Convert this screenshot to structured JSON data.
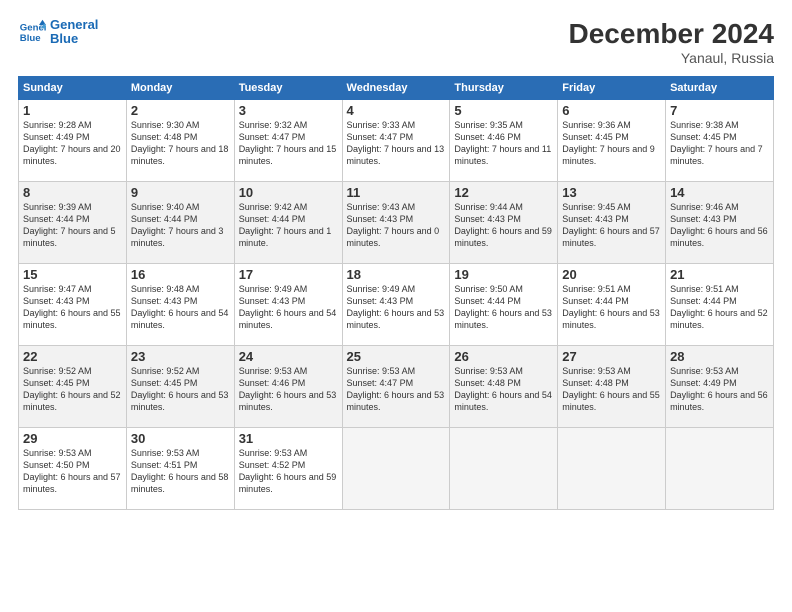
{
  "header": {
    "logo_line1": "General",
    "logo_line2": "Blue",
    "title": "December 2024",
    "subtitle": "Yanaul, Russia"
  },
  "days_of_week": [
    "Sunday",
    "Monday",
    "Tuesday",
    "Wednesday",
    "Thursday",
    "Friday",
    "Saturday"
  ],
  "weeks": [
    [
      {
        "num": "1",
        "sunrise": "Sunrise: 9:28 AM",
        "sunset": "Sunset: 4:49 PM",
        "daylight": "Daylight: 7 hours and 20 minutes."
      },
      {
        "num": "2",
        "sunrise": "Sunrise: 9:30 AM",
        "sunset": "Sunset: 4:48 PM",
        "daylight": "Daylight: 7 hours and 18 minutes."
      },
      {
        "num": "3",
        "sunrise": "Sunrise: 9:32 AM",
        "sunset": "Sunset: 4:47 PM",
        "daylight": "Daylight: 7 hours and 15 minutes."
      },
      {
        "num": "4",
        "sunrise": "Sunrise: 9:33 AM",
        "sunset": "Sunset: 4:47 PM",
        "daylight": "Daylight: 7 hours and 13 minutes."
      },
      {
        "num": "5",
        "sunrise": "Sunrise: 9:35 AM",
        "sunset": "Sunset: 4:46 PM",
        "daylight": "Daylight: 7 hours and 11 minutes."
      },
      {
        "num": "6",
        "sunrise": "Sunrise: 9:36 AM",
        "sunset": "Sunset: 4:45 PM",
        "daylight": "Daylight: 7 hours and 9 minutes."
      },
      {
        "num": "7",
        "sunrise": "Sunrise: 9:38 AM",
        "sunset": "Sunset: 4:45 PM",
        "daylight": "Daylight: 7 hours and 7 minutes."
      }
    ],
    [
      {
        "num": "8",
        "sunrise": "Sunrise: 9:39 AM",
        "sunset": "Sunset: 4:44 PM",
        "daylight": "Daylight: 7 hours and 5 minutes."
      },
      {
        "num": "9",
        "sunrise": "Sunrise: 9:40 AM",
        "sunset": "Sunset: 4:44 PM",
        "daylight": "Daylight: 7 hours and 3 minutes."
      },
      {
        "num": "10",
        "sunrise": "Sunrise: 9:42 AM",
        "sunset": "Sunset: 4:44 PM",
        "daylight": "Daylight: 7 hours and 1 minute."
      },
      {
        "num": "11",
        "sunrise": "Sunrise: 9:43 AM",
        "sunset": "Sunset: 4:43 PM",
        "daylight": "Daylight: 7 hours and 0 minutes."
      },
      {
        "num": "12",
        "sunrise": "Sunrise: 9:44 AM",
        "sunset": "Sunset: 4:43 PM",
        "daylight": "Daylight: 6 hours and 59 minutes."
      },
      {
        "num": "13",
        "sunrise": "Sunrise: 9:45 AM",
        "sunset": "Sunset: 4:43 PM",
        "daylight": "Daylight: 6 hours and 57 minutes."
      },
      {
        "num": "14",
        "sunrise": "Sunrise: 9:46 AM",
        "sunset": "Sunset: 4:43 PM",
        "daylight": "Daylight: 6 hours and 56 minutes."
      }
    ],
    [
      {
        "num": "15",
        "sunrise": "Sunrise: 9:47 AM",
        "sunset": "Sunset: 4:43 PM",
        "daylight": "Daylight: 6 hours and 55 minutes."
      },
      {
        "num": "16",
        "sunrise": "Sunrise: 9:48 AM",
        "sunset": "Sunset: 4:43 PM",
        "daylight": "Daylight: 6 hours and 54 minutes."
      },
      {
        "num": "17",
        "sunrise": "Sunrise: 9:49 AM",
        "sunset": "Sunset: 4:43 PM",
        "daylight": "Daylight: 6 hours and 54 minutes."
      },
      {
        "num": "18",
        "sunrise": "Sunrise: 9:49 AM",
        "sunset": "Sunset: 4:43 PM",
        "daylight": "Daylight: 6 hours and 53 minutes."
      },
      {
        "num": "19",
        "sunrise": "Sunrise: 9:50 AM",
        "sunset": "Sunset: 4:44 PM",
        "daylight": "Daylight: 6 hours and 53 minutes."
      },
      {
        "num": "20",
        "sunrise": "Sunrise: 9:51 AM",
        "sunset": "Sunset: 4:44 PM",
        "daylight": "Daylight: 6 hours and 53 minutes."
      },
      {
        "num": "21",
        "sunrise": "Sunrise: 9:51 AM",
        "sunset": "Sunset: 4:44 PM",
        "daylight": "Daylight: 6 hours and 52 minutes."
      }
    ],
    [
      {
        "num": "22",
        "sunrise": "Sunrise: 9:52 AM",
        "sunset": "Sunset: 4:45 PM",
        "daylight": "Daylight: 6 hours and 52 minutes."
      },
      {
        "num": "23",
        "sunrise": "Sunrise: 9:52 AM",
        "sunset": "Sunset: 4:45 PM",
        "daylight": "Daylight: 6 hours and 53 minutes."
      },
      {
        "num": "24",
        "sunrise": "Sunrise: 9:53 AM",
        "sunset": "Sunset: 4:46 PM",
        "daylight": "Daylight: 6 hours and 53 minutes."
      },
      {
        "num": "25",
        "sunrise": "Sunrise: 9:53 AM",
        "sunset": "Sunset: 4:47 PM",
        "daylight": "Daylight: 6 hours and 53 minutes."
      },
      {
        "num": "26",
        "sunrise": "Sunrise: 9:53 AM",
        "sunset": "Sunset: 4:48 PM",
        "daylight": "Daylight: 6 hours and 54 minutes."
      },
      {
        "num": "27",
        "sunrise": "Sunrise: 9:53 AM",
        "sunset": "Sunset: 4:48 PM",
        "daylight": "Daylight: 6 hours and 55 minutes."
      },
      {
        "num": "28",
        "sunrise": "Sunrise: 9:53 AM",
        "sunset": "Sunset: 4:49 PM",
        "daylight": "Daylight: 6 hours and 56 minutes."
      }
    ],
    [
      {
        "num": "29",
        "sunrise": "Sunrise: 9:53 AM",
        "sunset": "Sunset: 4:50 PM",
        "daylight": "Daylight: 6 hours and 57 minutes."
      },
      {
        "num": "30",
        "sunrise": "Sunrise: 9:53 AM",
        "sunset": "Sunset: 4:51 PM",
        "daylight": "Daylight: 6 hours and 58 minutes."
      },
      {
        "num": "31",
        "sunrise": "Sunrise: 9:53 AM",
        "sunset": "Sunset: 4:52 PM",
        "daylight": "Daylight: 6 hours and 59 minutes."
      },
      null,
      null,
      null,
      null
    ]
  ]
}
